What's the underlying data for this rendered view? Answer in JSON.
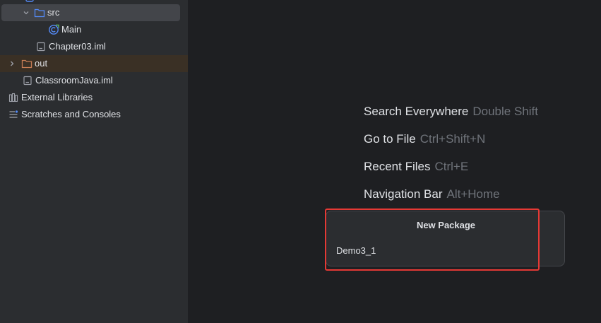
{
  "project_tree": {
    "items": [
      {
        "label": "src"
      },
      {
        "label": "Main"
      },
      {
        "label": "Chapter03.iml"
      },
      {
        "label": "out"
      },
      {
        "label": "ClassroomJava.iml"
      },
      {
        "label": "External Libraries"
      },
      {
        "label": "Scratches and Consoles"
      }
    ]
  },
  "editor_hints": [
    {
      "action": "Search Everywhere",
      "shortcut": "Double Shift"
    },
    {
      "action": "Go to File",
      "shortcut": "Ctrl+Shift+N"
    },
    {
      "action": "Recent Files",
      "shortcut": "Ctrl+E"
    },
    {
      "action": "Navigation Bar",
      "shortcut": "Alt+Home"
    }
  ],
  "new_package_popup": {
    "title": "New Package",
    "value": "Demo3_1"
  },
  "colors": {
    "panel_bg": "#2b2d30",
    "editor_bg": "#1e1f22",
    "selection_bg": "#43454a",
    "excluded_bg": "#3a3025",
    "folder_blue": "#548af7",
    "folder_orange": "#c77d55",
    "highlight_red": "#e53935"
  }
}
